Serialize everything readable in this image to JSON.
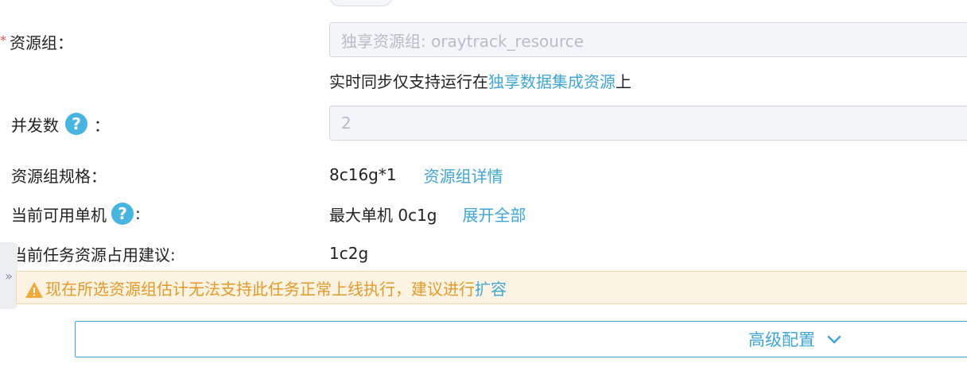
{
  "resource_group": {
    "label": "资源组：",
    "placeholder": "独享资源组: oraytrack_resource",
    "hint_prefix": "实时同步仅支持运行在",
    "hint_link": "独享数据集成资源",
    "hint_suffix": "上"
  },
  "concurrency": {
    "label": "并发数",
    "colon": "：",
    "value": "2"
  },
  "spec": {
    "label": "资源组规格：",
    "value": "8c16g*1",
    "link": "资源组详情"
  },
  "available_machine": {
    "label": "当前可用单机",
    "colon": ":",
    "value": "最大单机 0c1g",
    "link": "展开全部"
  },
  "suggestion": {
    "label": "当前任务资源占用建议:",
    "value": "1c2g"
  },
  "warning": {
    "text": "现在所选资源组估计无法支持此任务正常上线执行，建议进行",
    "link": "扩容"
  },
  "advanced": {
    "label": "高级配置"
  },
  "collapse_handle": {
    "glyph": "»"
  },
  "colors": {
    "link": "#3ea6d6",
    "help_icon": "#48b4e0",
    "warning_text": "#e39a2b",
    "warning_bg": "#fdf3e3",
    "required": "#e5484d"
  },
  "icons": {
    "help": "question-circle-icon",
    "warning": "warning-triangle-icon",
    "chevron": "chevron-down-icon"
  }
}
